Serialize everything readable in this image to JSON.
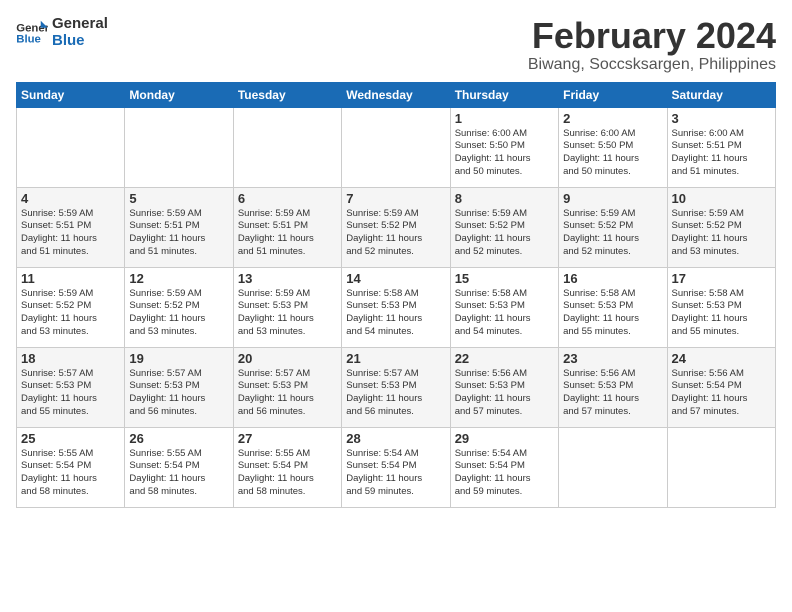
{
  "logo": {
    "line1": "General",
    "line2": "Blue"
  },
  "title": "February 2024",
  "location": "Biwang, Soccsksargen, Philippines",
  "days_header": [
    "Sunday",
    "Monday",
    "Tuesday",
    "Wednesday",
    "Thursday",
    "Friday",
    "Saturday"
  ],
  "weeks": [
    [
      {
        "num": "",
        "info": ""
      },
      {
        "num": "",
        "info": ""
      },
      {
        "num": "",
        "info": ""
      },
      {
        "num": "",
        "info": ""
      },
      {
        "num": "1",
        "info": "Sunrise: 6:00 AM\nSunset: 5:50 PM\nDaylight: 11 hours\nand 50 minutes."
      },
      {
        "num": "2",
        "info": "Sunrise: 6:00 AM\nSunset: 5:50 PM\nDaylight: 11 hours\nand 50 minutes."
      },
      {
        "num": "3",
        "info": "Sunrise: 6:00 AM\nSunset: 5:51 PM\nDaylight: 11 hours\nand 51 minutes."
      }
    ],
    [
      {
        "num": "4",
        "info": "Sunrise: 5:59 AM\nSunset: 5:51 PM\nDaylight: 11 hours\nand 51 minutes."
      },
      {
        "num": "5",
        "info": "Sunrise: 5:59 AM\nSunset: 5:51 PM\nDaylight: 11 hours\nand 51 minutes."
      },
      {
        "num": "6",
        "info": "Sunrise: 5:59 AM\nSunset: 5:51 PM\nDaylight: 11 hours\nand 51 minutes."
      },
      {
        "num": "7",
        "info": "Sunrise: 5:59 AM\nSunset: 5:52 PM\nDaylight: 11 hours\nand 52 minutes."
      },
      {
        "num": "8",
        "info": "Sunrise: 5:59 AM\nSunset: 5:52 PM\nDaylight: 11 hours\nand 52 minutes."
      },
      {
        "num": "9",
        "info": "Sunrise: 5:59 AM\nSunset: 5:52 PM\nDaylight: 11 hours\nand 52 minutes."
      },
      {
        "num": "10",
        "info": "Sunrise: 5:59 AM\nSunset: 5:52 PM\nDaylight: 11 hours\nand 53 minutes."
      }
    ],
    [
      {
        "num": "11",
        "info": "Sunrise: 5:59 AM\nSunset: 5:52 PM\nDaylight: 11 hours\nand 53 minutes."
      },
      {
        "num": "12",
        "info": "Sunrise: 5:59 AM\nSunset: 5:52 PM\nDaylight: 11 hours\nand 53 minutes."
      },
      {
        "num": "13",
        "info": "Sunrise: 5:59 AM\nSunset: 5:53 PM\nDaylight: 11 hours\nand 53 minutes."
      },
      {
        "num": "14",
        "info": "Sunrise: 5:58 AM\nSunset: 5:53 PM\nDaylight: 11 hours\nand 54 minutes."
      },
      {
        "num": "15",
        "info": "Sunrise: 5:58 AM\nSunset: 5:53 PM\nDaylight: 11 hours\nand 54 minutes."
      },
      {
        "num": "16",
        "info": "Sunrise: 5:58 AM\nSunset: 5:53 PM\nDaylight: 11 hours\nand 55 minutes."
      },
      {
        "num": "17",
        "info": "Sunrise: 5:58 AM\nSunset: 5:53 PM\nDaylight: 11 hours\nand 55 minutes."
      }
    ],
    [
      {
        "num": "18",
        "info": "Sunrise: 5:57 AM\nSunset: 5:53 PM\nDaylight: 11 hours\nand 55 minutes."
      },
      {
        "num": "19",
        "info": "Sunrise: 5:57 AM\nSunset: 5:53 PM\nDaylight: 11 hours\nand 56 minutes."
      },
      {
        "num": "20",
        "info": "Sunrise: 5:57 AM\nSunset: 5:53 PM\nDaylight: 11 hours\nand 56 minutes."
      },
      {
        "num": "21",
        "info": "Sunrise: 5:57 AM\nSunset: 5:53 PM\nDaylight: 11 hours\nand 56 minutes."
      },
      {
        "num": "22",
        "info": "Sunrise: 5:56 AM\nSunset: 5:53 PM\nDaylight: 11 hours\nand 57 minutes."
      },
      {
        "num": "23",
        "info": "Sunrise: 5:56 AM\nSunset: 5:53 PM\nDaylight: 11 hours\nand 57 minutes."
      },
      {
        "num": "24",
        "info": "Sunrise: 5:56 AM\nSunset: 5:54 PM\nDaylight: 11 hours\nand 57 minutes."
      }
    ],
    [
      {
        "num": "25",
        "info": "Sunrise: 5:55 AM\nSunset: 5:54 PM\nDaylight: 11 hours\nand 58 minutes."
      },
      {
        "num": "26",
        "info": "Sunrise: 5:55 AM\nSunset: 5:54 PM\nDaylight: 11 hours\nand 58 minutes."
      },
      {
        "num": "27",
        "info": "Sunrise: 5:55 AM\nSunset: 5:54 PM\nDaylight: 11 hours\nand 58 minutes."
      },
      {
        "num": "28",
        "info": "Sunrise: 5:54 AM\nSunset: 5:54 PM\nDaylight: 11 hours\nand 59 minutes."
      },
      {
        "num": "29",
        "info": "Sunrise: 5:54 AM\nSunset: 5:54 PM\nDaylight: 11 hours\nand 59 minutes."
      },
      {
        "num": "",
        "info": ""
      },
      {
        "num": "",
        "info": ""
      }
    ]
  ]
}
